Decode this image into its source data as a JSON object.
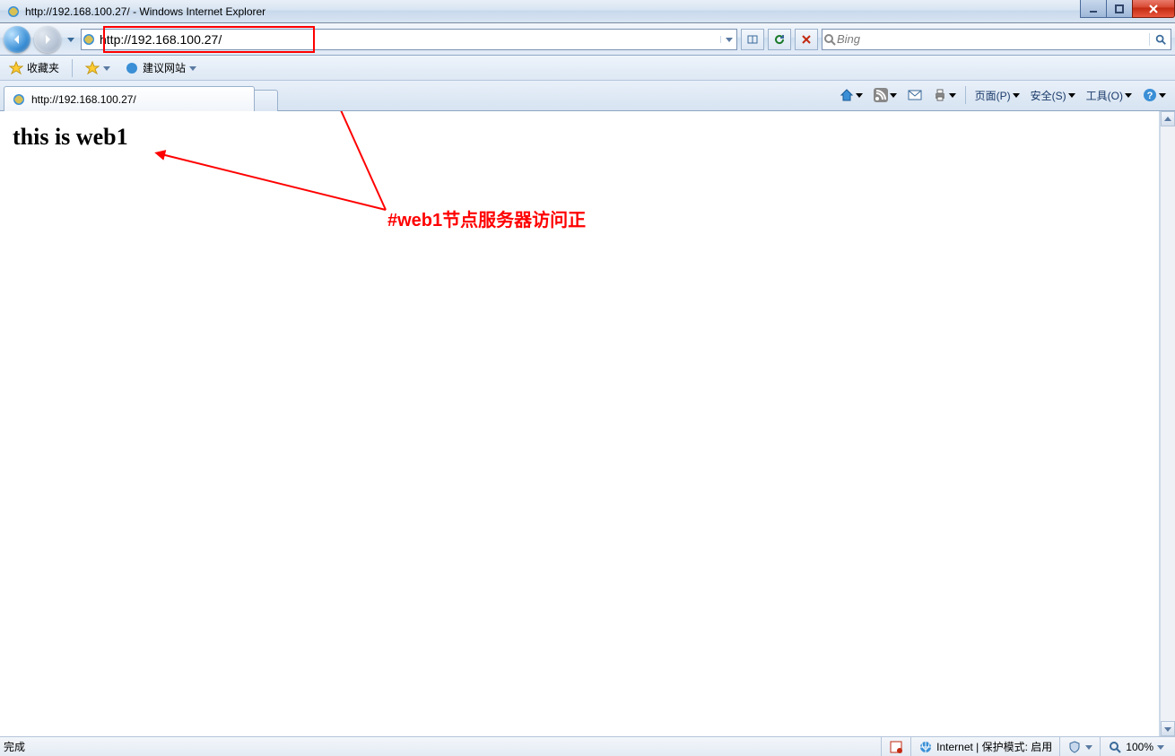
{
  "window": {
    "title": "http://192.168.100.27/ - Windows Internet Explorer"
  },
  "nav": {
    "url": "http://192.168.100.27/",
    "search_placeholder": "Bing"
  },
  "favbar": {
    "favorites_label": "收藏夹",
    "suggested_label": "建议网站"
  },
  "tab": {
    "title": "http://192.168.100.27/"
  },
  "cmd": {
    "page": "页面(P)",
    "safety": "安全(S)",
    "tools": "工具(O)"
  },
  "page": {
    "heading": "this is web1"
  },
  "annotation": {
    "text": "#web1节点服务器访问正"
  },
  "status": {
    "left": "完成",
    "zone": "Internet | 保护模式: 启用",
    "zoom": "100%"
  }
}
